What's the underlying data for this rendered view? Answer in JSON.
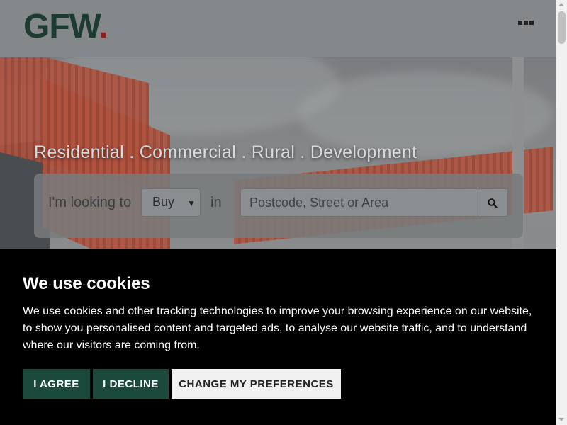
{
  "header": {
    "logo_text": "GFW",
    "logo_dot": ".",
    "menu_icon": "ellipsis-menu-icon"
  },
  "hero": {
    "tagline": "Residential . Commercial . Rural . Development",
    "search": {
      "label": "I'm looking to",
      "type_value": "Buy",
      "in_label": "in",
      "placeholder": "Postcode, Street or Area",
      "button_icon": "search-icon"
    }
  },
  "cookie": {
    "title": "We use cookies",
    "body": "We use cookies and other tracking technologies to improve your browsing experience on our website, to show you personalised content and targeted ads, to analyse our website traffic, and to understand where our visitors are coming from.",
    "agree_label": "I AGREE",
    "decline_label": "I DECLINE",
    "prefs_label": "CHANGE MY PREFERENCES"
  },
  "colors": {
    "brand_green": "#1d3b30",
    "brand_red": "#9c1b1b",
    "button_green": "#1b4a3c"
  }
}
